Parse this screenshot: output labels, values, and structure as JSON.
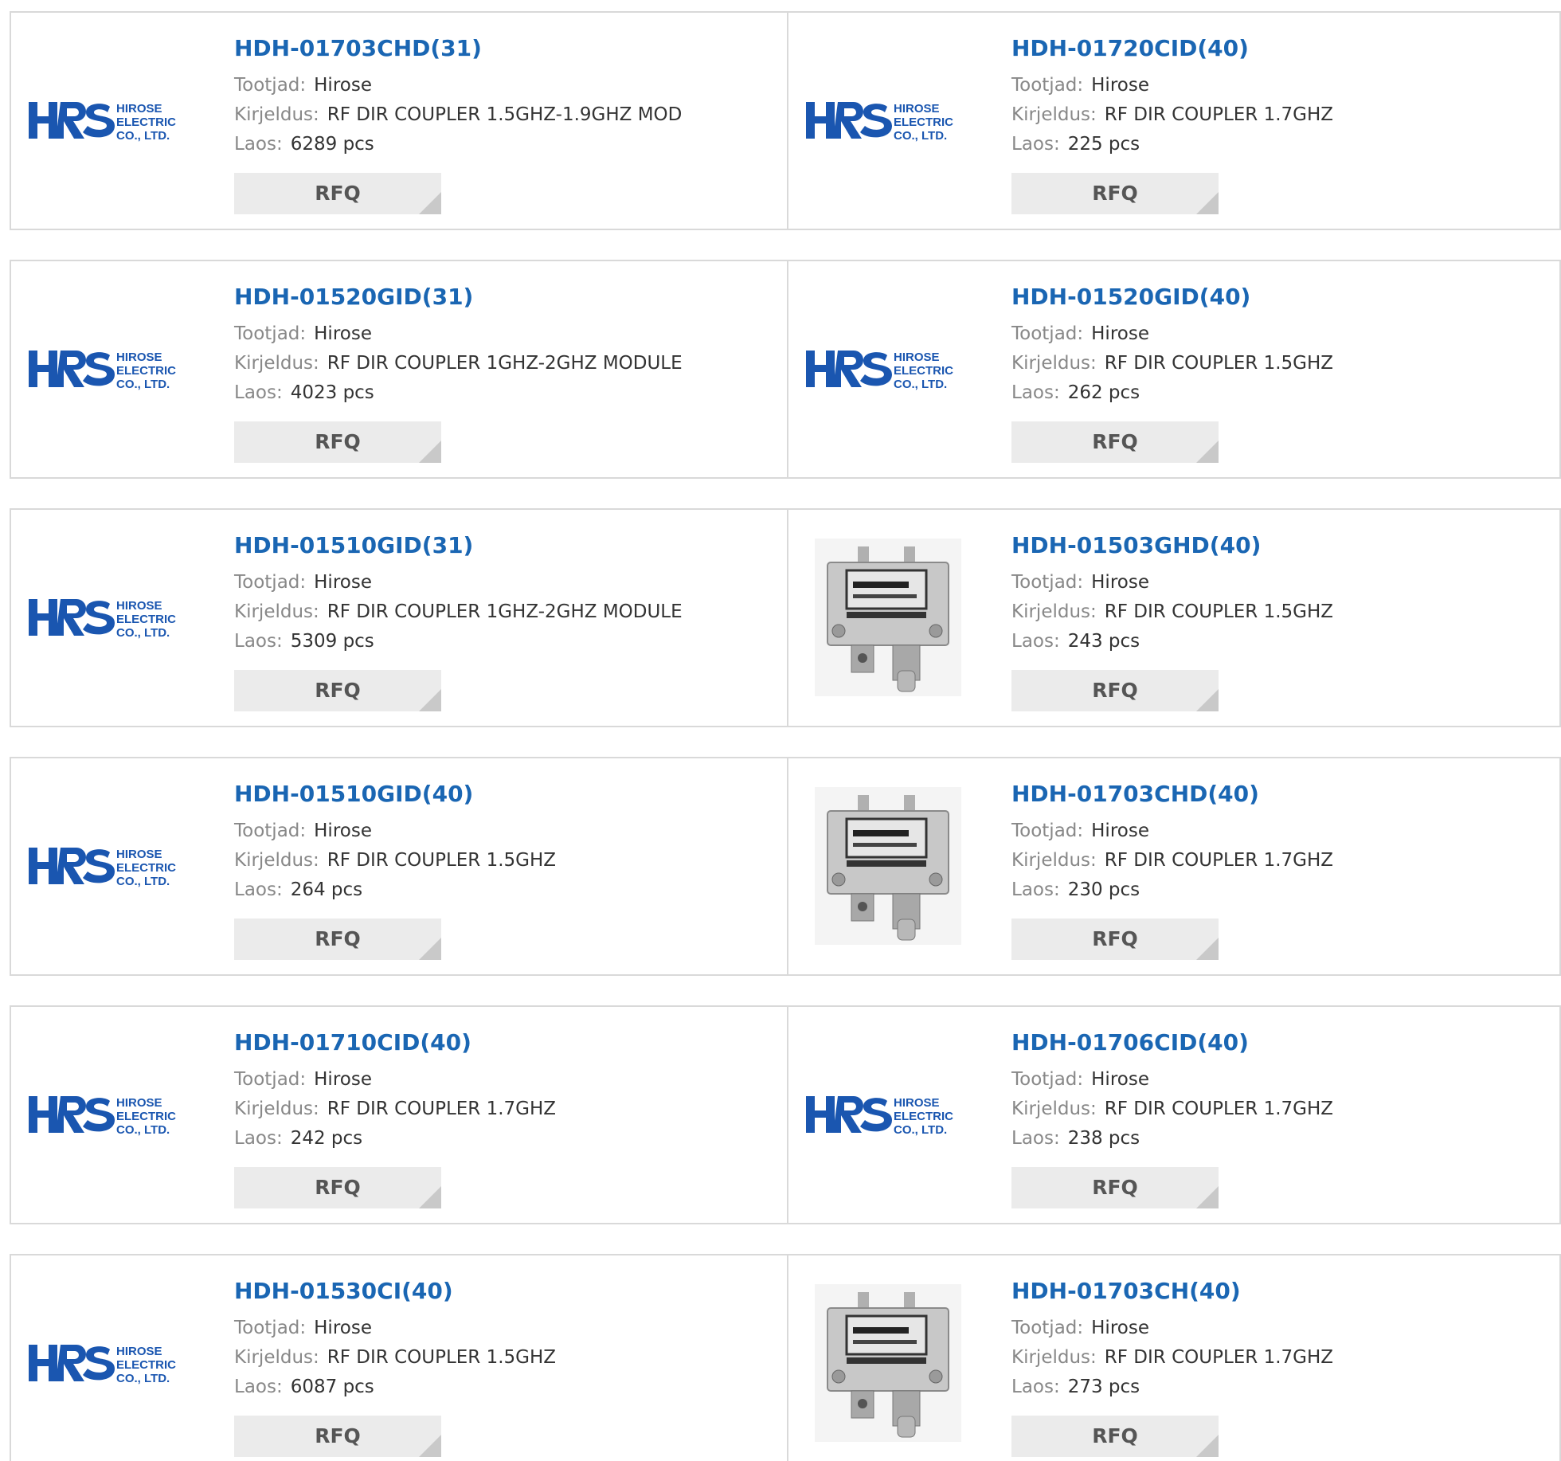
{
  "colors": {
    "accent": "#1a66b3",
    "border": "#d9d9d9",
    "button_bg": "#ebebeb",
    "label": "#888888",
    "text": "#333333"
  },
  "labels": {
    "manufacturer": "Tootjad:",
    "description": "Kirjeldus:",
    "stock": "Laos:",
    "rfq": "RFQ"
  },
  "logo": {
    "mark": "HRS",
    "line1": "HIROSE",
    "line2": "ELECTRIC",
    "line3": "CO., LTD."
  },
  "products": [
    {
      "part": "HDH-01703CHD(31)",
      "manufacturer": "Hirose",
      "description": "RF DIR COUPLER 1.5GHZ-1.9GHZ MOD",
      "stock": "6289 pcs",
      "image": "hirose-logo"
    },
    {
      "part": "HDH-01720CID(40)",
      "manufacturer": "Hirose",
      "description": "RF DIR COUPLER 1.7GHZ",
      "stock": "225 pcs",
      "image": "hirose-logo"
    },
    {
      "part": "HDH-01520GID(31)",
      "manufacturer": "Hirose",
      "description": "RF DIR COUPLER 1GHZ-2GHZ MODULE",
      "stock": "4023 pcs",
      "image": "hirose-logo"
    },
    {
      "part": "HDH-01520GID(40)",
      "manufacturer": "Hirose",
      "description": "RF DIR COUPLER 1.5GHZ",
      "stock": "262 pcs",
      "image": "hirose-logo"
    },
    {
      "part": "HDH-01510GID(31)",
      "manufacturer": "Hirose",
      "description": "RF DIR COUPLER 1GHZ-2GHZ MODULE",
      "stock": "5309 pcs",
      "image": "hirose-logo"
    },
    {
      "part": "HDH-01503GHD(40)",
      "manufacturer": "Hirose",
      "description": "RF DIR COUPLER 1.5GHZ",
      "stock": "243 pcs",
      "image": "coupler-photo"
    },
    {
      "part": "HDH-01510GID(40)",
      "manufacturer": "Hirose",
      "description": "RF DIR COUPLER 1.5GHZ",
      "stock": "264 pcs",
      "image": "hirose-logo"
    },
    {
      "part": "HDH-01703CHD(40)",
      "manufacturer": "Hirose",
      "description": "RF DIR COUPLER 1.7GHZ",
      "stock": "230 pcs",
      "image": "coupler-photo"
    },
    {
      "part": "HDH-01710CID(40)",
      "manufacturer": "Hirose",
      "description": "RF DIR COUPLER 1.7GHZ",
      "stock": "242 pcs",
      "image": "hirose-logo"
    },
    {
      "part": "HDH-01706CID(40)",
      "manufacturer": "Hirose",
      "description": "RF DIR COUPLER 1.7GHZ",
      "stock": "238 pcs",
      "image": "hirose-logo"
    },
    {
      "part": "HDH-01530CI(40)",
      "manufacturer": "Hirose",
      "description": "RF DIR COUPLER 1.5GHZ",
      "stock": "6087 pcs",
      "image": "hirose-logo"
    },
    {
      "part": "HDH-01703CH(40)",
      "manufacturer": "Hirose",
      "description": "RF DIR COUPLER 1.7GHZ",
      "stock": "273 pcs",
      "image": "coupler-photo"
    }
  ]
}
